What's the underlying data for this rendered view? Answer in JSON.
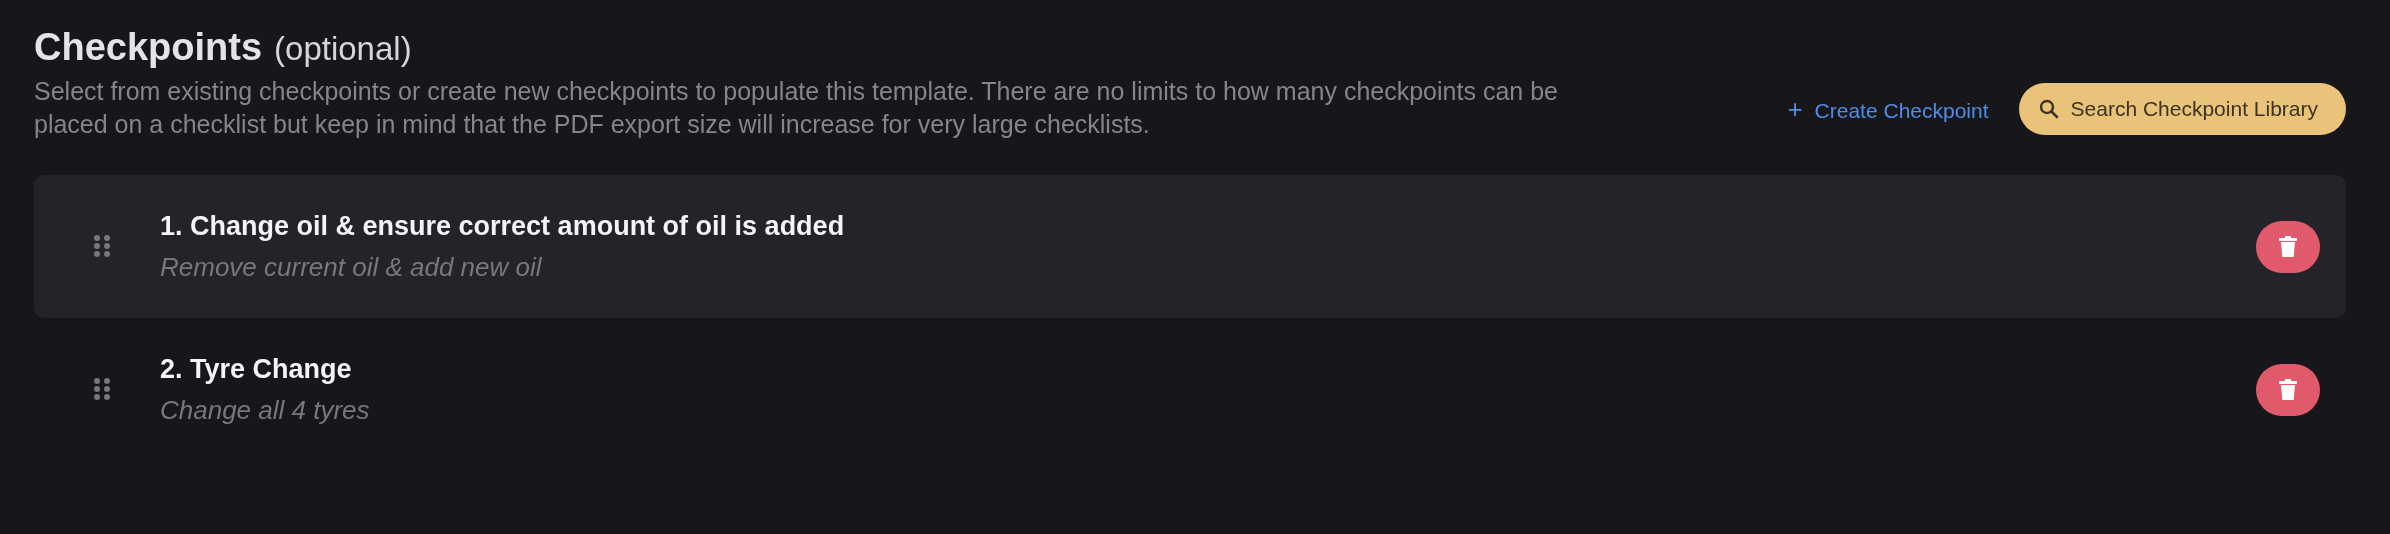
{
  "header": {
    "title": "Checkpoints",
    "title_note": "(optional)",
    "description": "Select from existing checkpoints or create new checkpoints to populate this template. There are no limits to how many checkpoints can be placed on a checklist but keep in mind that the PDF export size will increase for very large checklists."
  },
  "actions": {
    "create_label": "+",
    "create_text": "Create Checkpoint",
    "search_label": "Search Checkpoint Library"
  },
  "checkpoints": [
    {
      "title": "1. Change oil & ensure correct amount of oil is added",
      "subtitle": "Remove current oil & add new oil",
      "selected": true
    },
    {
      "title": "2. Tyre Change",
      "subtitle": "Change all 4 tyres",
      "selected": false
    }
  ]
}
